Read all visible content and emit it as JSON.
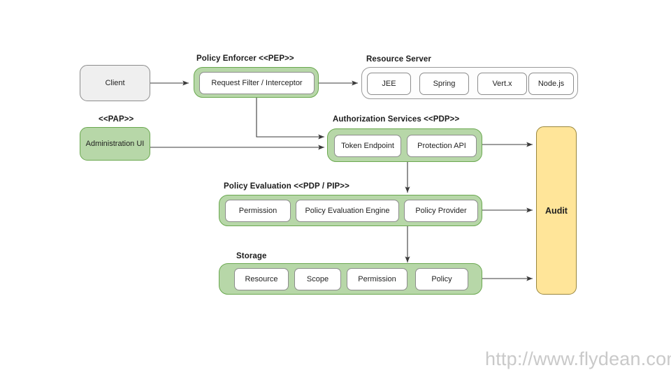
{
  "diagram": {
    "title_watermark": "http://www.flydean.com",
    "groups": {
      "policy_enforcer": {
        "label": "Policy Enforcer <<PEP>>",
        "nodes": [
          {
            "label": "Request Filter / Interceptor"
          }
        ]
      },
      "resource_server": {
        "label": "Resource Server",
        "nodes": [
          {
            "label": "JEE"
          },
          {
            "label": "Spring"
          },
          {
            "label": "Vert.x"
          },
          {
            "label": "Node.js"
          }
        ]
      },
      "pap": {
        "label": "<<PAP>>",
        "nodes": [
          {
            "label": "Administration UI"
          }
        ]
      },
      "authorization_services": {
        "label": "Authorization Services <<PDP>>",
        "nodes": [
          {
            "label": "Token Endpoint"
          },
          {
            "label": "Protection API"
          }
        ]
      },
      "policy_evaluation": {
        "label": "Policy Evaluation <<PDP / PIP>>",
        "nodes": [
          {
            "label": "Permission"
          },
          {
            "label": "Policy Evaluation Engine"
          },
          {
            "label": "Policy Provider"
          }
        ]
      },
      "storage": {
        "label": "Storage",
        "nodes": [
          {
            "label": "Resource"
          },
          {
            "label": "Scope"
          },
          {
            "label": "Permission"
          },
          {
            "label": "Policy"
          }
        ]
      }
    },
    "standalone": {
      "client": {
        "label": "Client"
      },
      "audit": {
        "label": "Audit"
      }
    },
    "colors": {
      "green_fill": "#b7d7a8",
      "green_border": "#6aa84f",
      "yellow_fill": "#ffe599",
      "yellow_border": "#99863d",
      "gray_fill": "#efefef",
      "gray_border": "#8c8c8c",
      "arrow": "#3b3b3b",
      "watermark": "#c9c9c9"
    }
  }
}
